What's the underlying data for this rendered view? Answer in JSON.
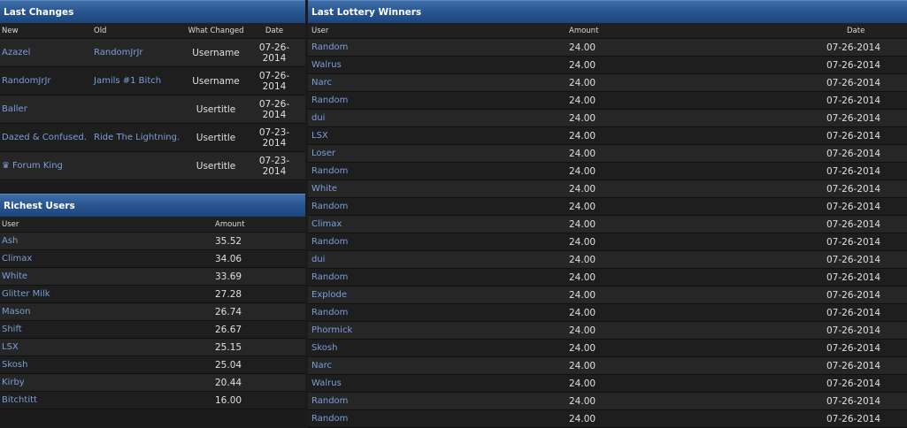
{
  "last_changes": {
    "title": "Last Changes",
    "headers": {
      "new": "New",
      "old": "Old",
      "what": "What Changed",
      "date": "Date"
    },
    "rows": [
      {
        "new": "Azazel",
        "old": "RandomJrJr",
        "what": "Username",
        "date_a": "07-26-",
        "date_b": "2014"
      },
      {
        "new": "RandomJrJr",
        "old": "Jamils #1 Bitch",
        "what": "Username",
        "date_a": "07-26-",
        "date_b": "2014"
      },
      {
        "new": "Baller",
        "old": "",
        "what": "Usertitle",
        "date_a": "07-26-",
        "date_b": "2014"
      },
      {
        "new": "Dazed & Confused.",
        "old": "Ride The Lightning.",
        "what": "Usertitle",
        "date_a": "07-23-",
        "date_b": "2014"
      },
      {
        "new": "Forum King",
        "old": "",
        "what": "Usertitle",
        "date_a": "07-23-",
        "date_b": "2014",
        "icon": "crown-icon"
      }
    ]
  },
  "richest_users": {
    "title": "Richest Users",
    "headers": {
      "user": "User",
      "amount": "Amount"
    },
    "rows": [
      {
        "user": "Ash",
        "amount": "35.52"
      },
      {
        "user": "Climax",
        "amount": "34.06"
      },
      {
        "user": "White",
        "amount": "33.69"
      },
      {
        "user": "Glitter Milk",
        "amount": "27.28"
      },
      {
        "user": "Mason",
        "amount": "26.74"
      },
      {
        "user": "Shift",
        "amount": "26.67"
      },
      {
        "user": "LSX",
        "amount": "25.15"
      },
      {
        "user": "Skosh",
        "amount": "25.04"
      },
      {
        "user": "Kirby",
        "amount": "20.44"
      },
      {
        "user": "Bitchtitt",
        "amount": "16.00"
      }
    ]
  },
  "lottery_winners": {
    "title": "Last Lottery Winners",
    "headers": {
      "user": "User",
      "amount": "Amount",
      "date": "Date"
    },
    "rows": [
      {
        "user": "Random",
        "amount": "24.00",
        "date": "07-26-2014"
      },
      {
        "user": "Walrus",
        "amount": "24.00",
        "date": "07-26-2014"
      },
      {
        "user": "Narc",
        "amount": "24.00",
        "date": "07-26-2014"
      },
      {
        "user": "Random",
        "amount": "24.00",
        "date": "07-26-2014"
      },
      {
        "user": "dui",
        "amount": "24.00",
        "date": "07-26-2014"
      },
      {
        "user": "LSX",
        "amount": "24.00",
        "date": "07-26-2014"
      },
      {
        "user": "Loser",
        "amount": "24.00",
        "date": "07-26-2014"
      },
      {
        "user": "Random",
        "amount": "24.00",
        "date": "07-26-2014"
      },
      {
        "user": "White",
        "amount": "24.00",
        "date": "07-26-2014"
      },
      {
        "user": "Random",
        "amount": "24.00",
        "date": "07-26-2014"
      },
      {
        "user": "Climax",
        "amount": "24.00",
        "date": "07-26-2014"
      },
      {
        "user": "Random",
        "amount": "24.00",
        "date": "07-26-2014"
      },
      {
        "user": "dui",
        "amount": "24.00",
        "date": "07-26-2014"
      },
      {
        "user": "Random",
        "amount": "24.00",
        "date": "07-26-2014"
      },
      {
        "user": "Explode",
        "amount": "24.00",
        "date": "07-26-2014"
      },
      {
        "user": "Random",
        "amount": "24.00",
        "date": "07-26-2014"
      },
      {
        "user": "Phormick",
        "amount": "24.00",
        "date": "07-26-2014"
      },
      {
        "user": "Skosh",
        "amount": "24.00",
        "date": "07-26-2014"
      },
      {
        "user": "Narc",
        "amount": "24.00",
        "date": "07-26-2014"
      },
      {
        "user": "Walrus",
        "amount": "24.00",
        "date": "07-26-2014"
      },
      {
        "user": "Random",
        "amount": "24.00",
        "date": "07-26-2014"
      },
      {
        "user": "Random",
        "amount": "24.00",
        "date": "07-26-2014"
      }
    ]
  },
  "colors": {
    "link": "#7b9fd8",
    "header_blue": "#29558f",
    "row_odd": "#262626",
    "row_even": "#1e1e1e"
  }
}
